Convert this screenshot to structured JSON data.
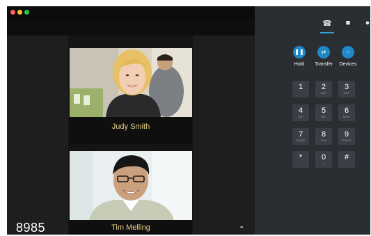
{
  "call": {
    "participants": [
      {
        "name": "Judy Smith"
      },
      {
        "name": "Tim Melling"
      }
    ],
    "extension": "8985"
  },
  "dialer": {
    "tabs": [
      {
        "icon": "phone-icon"
      },
      {
        "icon": "chat-icon"
      },
      {
        "icon": "contacts-icon"
      }
    ],
    "actions": [
      {
        "label": "Hold",
        "icon": "pause-icon"
      },
      {
        "label": "Transfer",
        "icon": "transfer-icon"
      },
      {
        "label": "Devices",
        "icon": "devices-icon"
      }
    ],
    "keypad": [
      {
        "digit": "1",
        "letters": ""
      },
      {
        "digit": "2",
        "letters": "ABC"
      },
      {
        "digit": "3",
        "letters": "DEF"
      },
      {
        "digit": "4",
        "letters": "GHI"
      },
      {
        "digit": "5",
        "letters": "JKL"
      },
      {
        "digit": "6",
        "letters": "MNO"
      },
      {
        "digit": "7",
        "letters": "PQRS"
      },
      {
        "digit": "8",
        "letters": "TUV"
      },
      {
        "digit": "9",
        "letters": "WXYZ"
      },
      {
        "digit": "*",
        "letters": ""
      },
      {
        "digit": "0",
        "letters": "+"
      },
      {
        "digit": "#",
        "letters": ""
      }
    ]
  },
  "colors": {
    "accent": "#1f88c6",
    "name_label": "#e8d28a",
    "panel": "#2a2e33"
  }
}
